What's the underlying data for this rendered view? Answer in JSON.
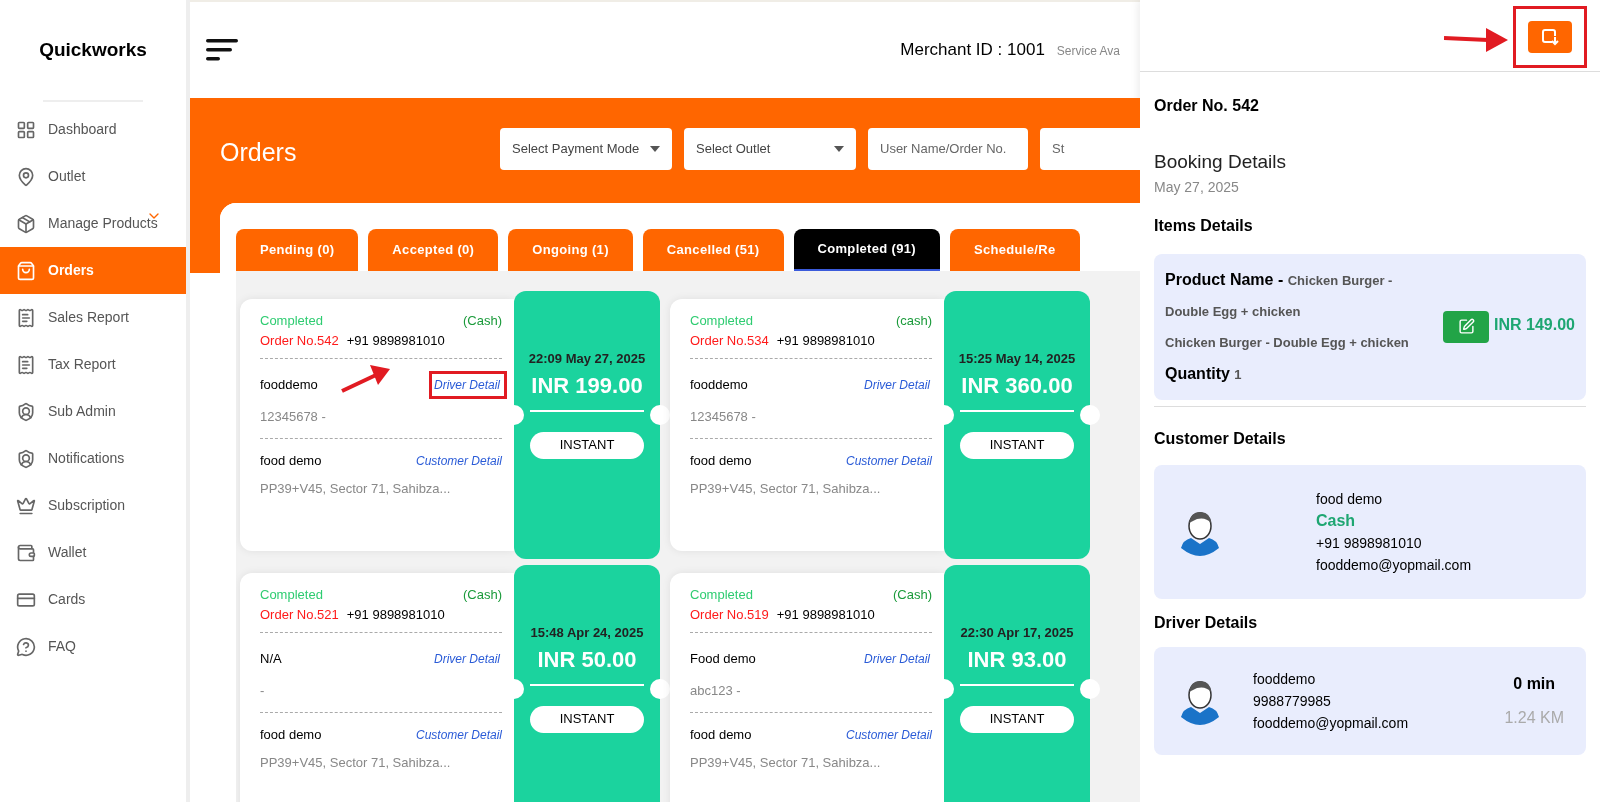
{
  "sidebar": {
    "logo": "Quickworks",
    "items": [
      {
        "label": "Dashboard",
        "selected": false,
        "expandable": false
      },
      {
        "label": "Outlet",
        "selected": false,
        "expandable": false
      },
      {
        "label": "Manage Products",
        "selected": false,
        "expandable": true
      },
      {
        "label": "Orders",
        "selected": true,
        "expandable": false
      },
      {
        "label": "Sales Report",
        "selected": false,
        "expandable": false
      },
      {
        "label": "Tax Report",
        "selected": false,
        "expandable": false
      },
      {
        "label": "Sub Admin",
        "selected": false,
        "expandable": false
      },
      {
        "label": "Notifications",
        "selected": false,
        "expandable": false
      },
      {
        "label": "Subscription",
        "selected": false,
        "expandable": false
      },
      {
        "label": "Wallet",
        "selected": false,
        "expandable": false
      },
      {
        "label": "Cards",
        "selected": false,
        "expandable": false
      },
      {
        "label": "FAQ",
        "selected": false,
        "expandable": false
      }
    ]
  },
  "header": {
    "merchant_id": "Merchant ID : 1001",
    "service": "Service Ava"
  },
  "page_title": "Orders",
  "filters": [
    {
      "kind": "select",
      "placeholder": "Select Payment Mode"
    },
    {
      "kind": "select",
      "placeholder": "Select Outlet"
    },
    {
      "kind": "input",
      "placeholder": "User Name/Order No."
    },
    {
      "kind": "input",
      "placeholder": "St"
    }
  ],
  "tabs": [
    {
      "label": "Pending (0)",
      "selected": false
    },
    {
      "label": "Accepted (0)",
      "selected": false
    },
    {
      "label": "Ongoing (1)",
      "selected": false
    },
    {
      "label": "Cancelled (51)",
      "selected": false
    },
    {
      "label": "Completed (91)",
      "selected": true
    },
    {
      "label": "Schedule/Re",
      "selected": false
    }
  ],
  "orders": [
    {
      "status": "Completed",
      "payment": "(Cash)",
      "order_no": "Order No.542",
      "phone": "+91 9898981010",
      "driver_name": "fooddemo",
      "driver_link": "Driver Detail",
      "driver_info": "12345678 -",
      "customer_name": "food demo",
      "customer_link": "Customer Detail",
      "address": "PP39+V45, Sector 71, Sahibza...",
      "datetime": "22:09 May 27, 2025",
      "amount": "INR 199.00",
      "type": "INSTANT",
      "highlighted": true
    },
    {
      "status": "Completed",
      "payment": "(cash)",
      "order_no": "Order No.534",
      "phone": "+91 9898981010",
      "driver_name": "fooddemo",
      "driver_link": "Driver Detail",
      "driver_info": "12345678 -",
      "customer_name": "food demo",
      "customer_link": "Customer Detail",
      "address": "PP39+V45, Sector 71, Sahibza...",
      "datetime": "15:25 May 14, 2025",
      "amount": "INR 360.00",
      "type": "INSTANT",
      "highlighted": false
    },
    {
      "status": "Completed",
      "payment": "(Cash)",
      "order_no": "Order No.521",
      "phone": "+91 9898981010",
      "driver_name": "N/A",
      "driver_link": "Driver Detail",
      "driver_info": "-",
      "customer_name": "food demo",
      "customer_link": "Customer Detail",
      "address": "PP39+V45, Sector 71, Sahibza...",
      "datetime": "15:48 Apr 24, 2025",
      "amount": "INR 50.00",
      "type": "INSTANT",
      "highlighted": false
    },
    {
      "status": "Completed",
      "payment": "(Cash)",
      "order_no": "Order No.519",
      "phone": "+91 9898981010",
      "driver_name": "Food demo",
      "driver_link": "Driver Detail",
      "driver_info": "abc123 -",
      "customer_name": "food demo",
      "customer_link": "Customer Detail",
      "address": "PP39+V45, Sector 71, Sahibza...",
      "datetime": "22:30 Apr 17, 2025",
      "amount": "INR 93.00",
      "type": "INSTANT",
      "highlighted": false
    }
  ],
  "drawer": {
    "button_highlighted": true,
    "order_no": "Order No. 542",
    "booking_title": "Booking Details",
    "booking_date": "May 27, 2025",
    "items_title": "Items Details",
    "item": {
      "product_label": "Product Name -",
      "product_value": "Chicken Burger - Double Egg + chicken",
      "variant": "Chicken Burger - Double Egg + chicken",
      "quantity_label": "Quantity",
      "quantity": "1",
      "price": "INR 149.00"
    },
    "customer_title": "Customer Details",
    "customer": {
      "name": "food demo",
      "payment": "Cash",
      "phone": "+91 9898981010",
      "email": "fooddemo@yopmail.com"
    },
    "driver_title": "Driver Details",
    "driver": {
      "name": "fooddemo",
      "phone": "9988779985",
      "email": "fooddemo@yopmail.com",
      "eta": "0 min",
      "distance": "1.24 KM"
    }
  }
}
